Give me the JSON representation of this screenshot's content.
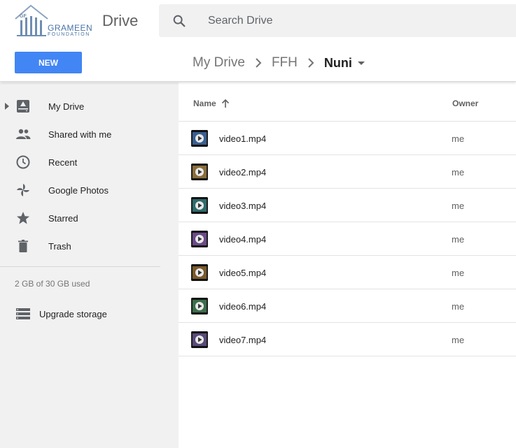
{
  "brand": {
    "logo_initials": "GF",
    "logo_word": "GRAMEEN",
    "logo_sub": "FOUNDATION",
    "app_name": "Drive"
  },
  "search": {
    "placeholder": "Search Drive",
    "icon": "search-icon"
  },
  "toolbar": {
    "new_label": "NEW",
    "accent": "#4285f4"
  },
  "breadcrumb": {
    "items": [
      "My Drive",
      "FFH"
    ],
    "current": "Nuni"
  },
  "sidebar": {
    "items": [
      {
        "label": "My Drive",
        "icon": "my-drive-icon"
      },
      {
        "label": "Shared with me",
        "icon": "people-icon"
      },
      {
        "label": "Recent",
        "icon": "clock-icon"
      },
      {
        "label": "Google Photos",
        "icon": "pinwheel-icon"
      },
      {
        "label": "Starred",
        "icon": "star-icon"
      },
      {
        "label": "Trash",
        "icon": "trash-icon"
      }
    ],
    "storage_text": "2 GB of 30 GB used",
    "upgrade_label": "Upgrade storage"
  },
  "list": {
    "columns": {
      "name": "Name",
      "owner": "Owner"
    },
    "files": [
      {
        "name": "video1.mp4",
        "owner": "me"
      },
      {
        "name": "video2.mp4",
        "owner": "me"
      },
      {
        "name": "video3.mp4",
        "owner": "me"
      },
      {
        "name": "video4.mp4",
        "owner": "me"
      },
      {
        "name": "video5.mp4",
        "owner": "me"
      },
      {
        "name": "video6.mp4",
        "owner": "me"
      },
      {
        "name": "video7.mp4",
        "owner": "me"
      }
    ]
  }
}
